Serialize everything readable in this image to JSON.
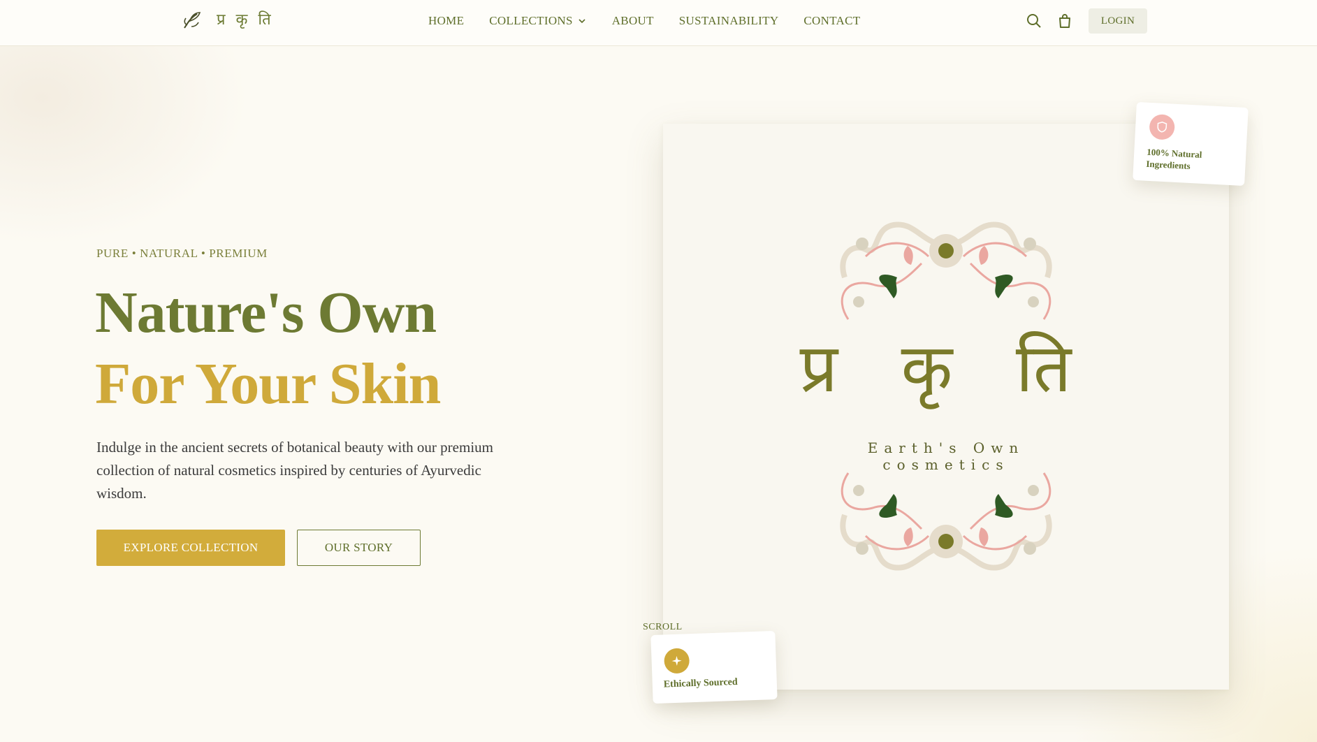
{
  "brand": {
    "logo_text": "प्र कृ ति"
  },
  "nav": {
    "items": [
      "HOME",
      "COLLECTIONS",
      "ABOUT",
      "SUSTAINABILITY",
      "CONTACT"
    ],
    "login_label": "LOGIN"
  },
  "hero": {
    "eyebrow": "PURE • NATURAL • PREMIUM",
    "title_line1": "Nature's Own",
    "title_line2": "For Your Skin",
    "lede": "Indulge in the ancient secrets of botanical beauty with our premium collection of natural cosmetics inspired by centuries of Ayurvedic wisdom.",
    "primary_cta": "EXPLORE COLLECTION",
    "secondary_cta": "OUR STORY"
  },
  "card": {
    "devanagari": "प्र कृ ति",
    "subtitle_line1": "Earth's Own",
    "subtitle_line2": "cosmetics"
  },
  "badges": {
    "natural": "100% Natural Ingredients",
    "ethical": "Ethically Sourced"
  },
  "scroll_label": "SCROLL",
  "colors": {
    "olive": "#6d7a33",
    "gold": "#cfa93a",
    "cream": "#fcfaf3",
    "pink": "#f3b5b0"
  }
}
